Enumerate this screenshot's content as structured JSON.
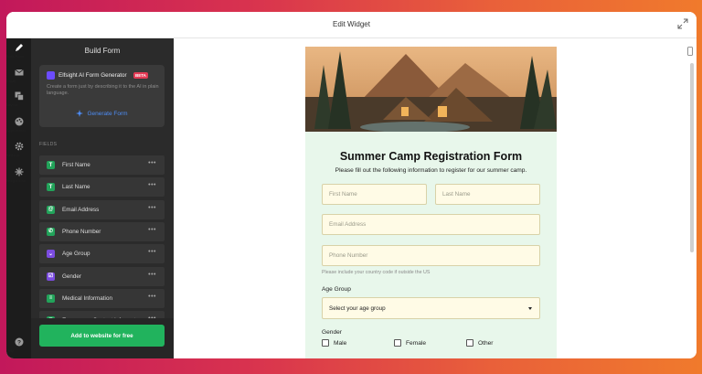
{
  "window": {
    "title": "Edit Widget"
  },
  "rail": {
    "items": [
      {
        "label": "Build Form",
        "icon": "pencil-icon"
      },
      {
        "label": "Email",
        "icon": "mail-icon"
      },
      {
        "label": "Layout",
        "icon": "layout-icon"
      },
      {
        "label": "Appearance",
        "icon": "palette-icon"
      },
      {
        "label": "Settings",
        "icon": "gear-icon"
      },
      {
        "label": "Integrations",
        "icon": "integrations-icon"
      }
    ],
    "help": {
      "label": "Help",
      "icon": "help-icon"
    }
  },
  "panel": {
    "title": "Build Form",
    "ai": {
      "name": "Elfsight AI Form Generator",
      "badge": "BETA",
      "description": "Create a form just by describing it to the AI in plain language.",
      "button": "Generate Form"
    },
    "fields_label": "FIELDS",
    "fields": [
      {
        "label": "First Name",
        "icon": "text-icon",
        "glyph": "T",
        "color": "#22a35a"
      },
      {
        "label": "Last Name",
        "icon": "text-icon",
        "glyph": "T",
        "color": "#22a35a"
      },
      {
        "label": "Email Address",
        "icon": "at-icon",
        "glyph": "@",
        "color": "#22a35a"
      },
      {
        "label": "Phone Number",
        "icon": "phone-icon",
        "glyph": "✆",
        "color": "#22a35a"
      },
      {
        "label": "Age Group",
        "icon": "dropdown-icon",
        "glyph": "⌄",
        "color": "#7b4ce0"
      },
      {
        "label": "Gender",
        "icon": "checkbox-icon",
        "glyph": "☑",
        "color": "#7b4ce0"
      },
      {
        "label": "Medical Information",
        "icon": "paragraph-icon",
        "glyph": "≡",
        "color": "#22a35a"
      },
      {
        "label": "Emergency Contact Informat",
        "icon": "text-icon",
        "glyph": "T",
        "color": "#22a35a"
      }
    ],
    "footer_button": "Add to website for free"
  },
  "form": {
    "title": "Summer Camp Registration Form",
    "subtitle": "Please fill out the following information to register for our summer camp.",
    "first_name_placeholder": "First Name",
    "last_name_placeholder": "Last Name",
    "email_placeholder": "Email Address",
    "phone_placeholder": "Phone Number",
    "phone_hint": "Please include your country code if outside the US",
    "age_label": "Age Group",
    "age_select": "Select your age group",
    "gender_label": "Gender",
    "gender_options": [
      "Male",
      "Female",
      "Other"
    ]
  },
  "colors": {
    "accent_green": "#21b35d",
    "link_blue": "#4e8df6",
    "beta_red": "#e33a55",
    "form_bg": "#e8f7eb",
    "input_bg": "#fffbe6"
  }
}
